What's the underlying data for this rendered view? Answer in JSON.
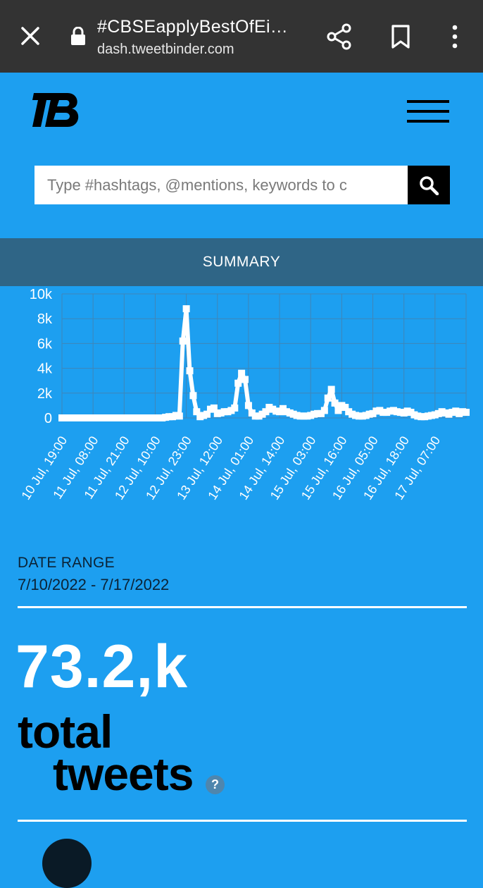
{
  "browser": {
    "tab_title": "#CBSEapplyBestOfEi…",
    "url": "dash.tweetbinder.com"
  },
  "search": {
    "placeholder": "Type #hashtags, @mentions, keywords to c"
  },
  "nav": {
    "summary_label": "SUMMARY"
  },
  "chart_data": {
    "type": "line",
    "color": "#ffffff",
    "y_ticks": [
      "0",
      "2k",
      "4k",
      "6k",
      "8k",
      "10k"
    ],
    "ylim": [
      0,
      10000
    ],
    "x_labels": [
      "10 Jul, 19:00",
      "11 Jul, 08:00",
      "11 Jul, 21:00",
      "12 Jul, 10:00",
      "12 Jul, 23:00",
      "13 Jul, 12:00",
      "14 Jul, 01:00",
      "14 Jul, 14:00",
      "15 Jul, 03:00",
      "15 Jul, 16:00",
      "16 Jul, 05:00",
      "16 Jul, 18:00",
      "17 Jul, 07:00"
    ],
    "grid": true,
    "points": [
      [
        0,
        0
      ],
      [
        1,
        0
      ],
      [
        2,
        0
      ],
      [
        3,
        0
      ],
      [
        4,
        0
      ],
      [
        5,
        0
      ],
      [
        6,
        0
      ],
      [
        7,
        0
      ],
      [
        8,
        0
      ],
      [
        9,
        0
      ],
      [
        10,
        0
      ],
      [
        11,
        0
      ],
      [
        12,
        0
      ],
      [
        13,
        0
      ],
      [
        14,
        0
      ],
      [
        15,
        0
      ],
      [
        16,
        0
      ],
      [
        17,
        0
      ],
      [
        18,
        0
      ],
      [
        19,
        0
      ],
      [
        20,
        0
      ],
      [
        21,
        0
      ],
      [
        22,
        0
      ],
      [
        23,
        0
      ],
      [
        24,
        0
      ],
      [
        25,
        0
      ],
      [
        26,
        0
      ],
      [
        27,
        0
      ],
      [
        28,
        0
      ],
      [
        29,
        0
      ],
      [
        30,
        50
      ],
      [
        31,
        100
      ],
      [
        32,
        100
      ],
      [
        33,
        200
      ],
      [
        34,
        150
      ],
      [
        35,
        6200
      ],
      [
        36,
        8800
      ],
      [
        37,
        3800
      ],
      [
        38,
        1800
      ],
      [
        39,
        500
      ],
      [
        40,
        100
      ],
      [
        41,
        200
      ],
      [
        42,
        300
      ],
      [
        43,
        700
      ],
      [
        44,
        800
      ],
      [
        45,
        350
      ],
      [
        46,
        400
      ],
      [
        47,
        500
      ],
      [
        48,
        500
      ],
      [
        49,
        600
      ],
      [
        50,
        800
      ],
      [
        51,
        2800
      ],
      [
        52,
        3600
      ],
      [
        53,
        3100
      ],
      [
        54,
        1000
      ],
      [
        55,
        400
      ],
      [
        56,
        150
      ],
      [
        57,
        150
      ],
      [
        58,
        300
      ],
      [
        59,
        500
      ],
      [
        60,
        850
      ],
      [
        61,
        700
      ],
      [
        62,
        550
      ],
      [
        63,
        500
      ],
      [
        64,
        750
      ],
      [
        65,
        500
      ],
      [
        66,
        400
      ],
      [
        67,
        300
      ],
      [
        68,
        200
      ],
      [
        69,
        150
      ],
      [
        70,
        150
      ],
      [
        71,
        150
      ],
      [
        72,
        200
      ],
      [
        73,
        300
      ],
      [
        74,
        350
      ],
      [
        75,
        350
      ],
      [
        76,
        600
      ],
      [
        77,
        1600
      ],
      [
        78,
        2300
      ],
      [
        79,
        1200
      ],
      [
        80,
        600
      ],
      [
        81,
        1000
      ],
      [
        82,
        850
      ],
      [
        83,
        500
      ],
      [
        84,
        300
      ],
      [
        85,
        200
      ],
      [
        86,
        150
      ],
      [
        87,
        150
      ],
      [
        88,
        200
      ],
      [
        89,
        300
      ],
      [
        90,
        350
      ],
      [
        91,
        550
      ],
      [
        92,
        600
      ],
      [
        93,
        450
      ],
      [
        94,
        450
      ],
      [
        95,
        550
      ],
      [
        96,
        600
      ],
      [
        97,
        500
      ],
      [
        98,
        450
      ],
      [
        99,
        400
      ],
      [
        100,
        550
      ],
      [
        101,
        450
      ],
      [
        102,
        250
      ],
      [
        103,
        150
      ],
      [
        104,
        100
      ],
      [
        105,
        100
      ],
      [
        106,
        150
      ],
      [
        107,
        200
      ],
      [
        108,
        250
      ],
      [
        109,
        350
      ],
      [
        110,
        500
      ],
      [
        111,
        400
      ],
      [
        112,
        300
      ],
      [
        113,
        450
      ],
      [
        114,
        550
      ],
      [
        115,
        350
      ],
      [
        116,
        500
      ],
      [
        117,
        450
      ]
    ]
  },
  "stats": {
    "date_range_label": "DATE RANGE",
    "date_range_value": "7/10/2022 - 7/17/2022",
    "total_value": "73.2,k",
    "total_word1": "total",
    "total_word2": "tweets",
    "help_glyph": "?"
  }
}
